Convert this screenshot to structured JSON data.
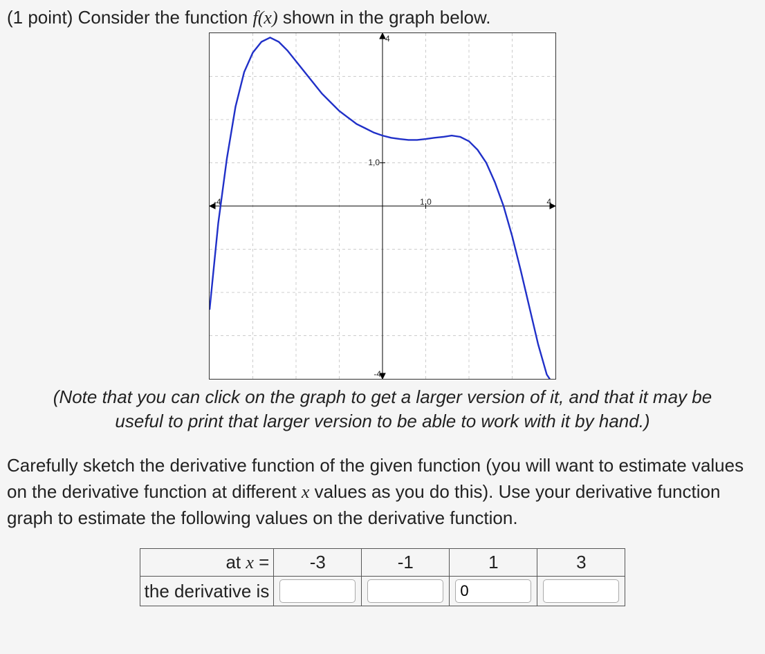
{
  "prompt": {
    "prefix": "(1 point) Consider the function ",
    "fn": "f(x)",
    "suffix": " shown in the graph below."
  },
  "note": "(Note that you can click on the graph to get a larger version of it, and that it may be useful to print that larger version to be able to work with it by hand.)",
  "instructions_pre": "Carefully sketch the derivative function of the given function (you will want to estimate values on the derivative function at different ",
  "instructions_var": "x",
  "instructions_post": " values as you do this). Use your derivative function graph to estimate the following values on the derivative function.",
  "table": {
    "row1_label_pre": "at ",
    "row1_label_var": "x",
    "row1_label_post": " =",
    "row2_label": "the derivative is",
    "x_values": [
      "-3",
      "-1",
      "1",
      "3"
    ],
    "answers": [
      "",
      "",
      "0",
      ""
    ]
  },
  "graph": {
    "x_axis_label_neg": "-4",
    "x_axis_label_pos": "4",
    "y_axis_label_pos": "4",
    "y_axis_label_neg": "-4",
    "x_tick_label": "1,0",
    "y_tick_label": "1,0"
  },
  "chart_data": {
    "type": "line",
    "title": "",
    "xlabel": "",
    "ylabel": "",
    "xlim": [
      -4,
      4
    ],
    "ylim": [
      -4,
      4
    ],
    "x_ticks": [
      -4,
      -3,
      -2,
      -1,
      0,
      1,
      2,
      3,
      4
    ],
    "y_ticks": [
      -4,
      -3,
      -2,
      -1,
      0,
      1,
      2,
      3,
      4
    ],
    "series": [
      {
        "name": "f(x)",
        "color": "#2030c8",
        "x": [
          -4.0,
          -3.8,
          -3.6,
          -3.4,
          -3.2,
          -3.0,
          -2.8,
          -2.6,
          -2.4,
          -2.2,
          -2.0,
          -1.8,
          -1.6,
          -1.4,
          -1.2,
          -1.0,
          -0.8,
          -0.6,
          -0.4,
          -0.2,
          0.0,
          0.2,
          0.4,
          0.6,
          0.8,
          1.0,
          1.2,
          1.4,
          1.6,
          1.8,
          2.0,
          2.2,
          2.4,
          2.6,
          2.8,
          3.0,
          3.2,
          3.4,
          3.6,
          3.8,
          4.0
        ],
        "y": [
          -2.4,
          -0.4,
          1.1,
          2.3,
          3.1,
          3.55,
          3.8,
          3.9,
          3.8,
          3.6,
          3.35,
          3.1,
          2.85,
          2.6,
          2.4,
          2.2,
          2.05,
          1.9,
          1.8,
          1.7,
          1.63,
          1.58,
          1.55,
          1.53,
          1.53,
          1.55,
          1.58,
          1.6,
          1.63,
          1.6,
          1.5,
          1.3,
          1.0,
          0.55,
          0.0,
          -0.7,
          -1.5,
          -2.35,
          -3.2,
          -3.9,
          -4.2
        ]
      }
    ]
  }
}
